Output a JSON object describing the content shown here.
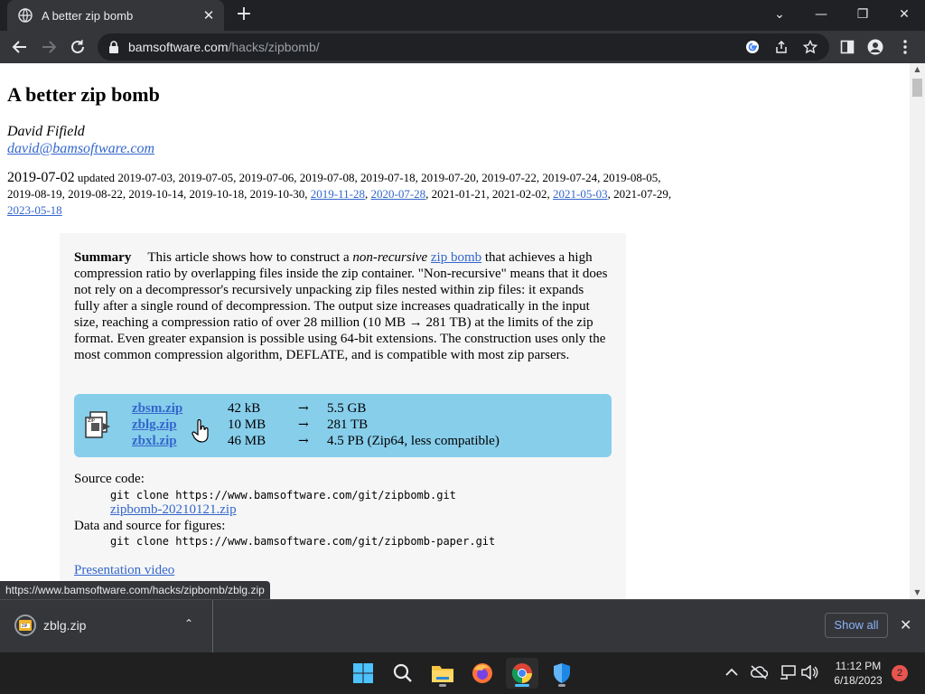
{
  "browser": {
    "tab": {
      "title": "A better zip bomb",
      "close": "✕"
    },
    "new_tab": "+",
    "window_controls": {
      "tab_search": "⌄",
      "minimize": "—",
      "restore": "❐",
      "close": "✕"
    },
    "address": {
      "domain": "bamsoftware.com",
      "path": "/hacks/zipbomb/"
    }
  },
  "page": {
    "title": "A better zip bomb",
    "author": "David Fifield",
    "email": "david@bamsoftware.com",
    "dates": {
      "published": "2019-07-02",
      "updated_label": "updated",
      "line1": "2019-07-03, 2019-07-05, 2019-07-06, 2019-07-08, 2019-07-18, 2019-07-20, 2019-07-22, 2019-07-24, 2019-08-05,",
      "line2_a": "2019-08-19, 2019-08-22, 2019-10-14, 2019-10-18, 2019-10-30, ",
      "link1": "2019-11-28",
      "sep1": ", ",
      "link2": "2020-07-28",
      "line2_b": ", 2021-01-21, 2021-02-02, ",
      "link3": "2021-05-03",
      "line2_c": ", 2021-07-29,",
      "link4": "2023-05-18"
    },
    "summary": {
      "heading": "Summary",
      "text1": "This article shows how to construct a ",
      "em": "non-recursive",
      "text2": " ",
      "link": "zip bomb",
      "text3": " that achieves a high compression ratio by overlapping files inside the zip container. \"Non-recursive\" means that it does not rely on a decompressor's recursively unpacking zip files nested within zip files: it expands fully after a single round of decompression. The output size increases quadratically in the input size, reaching a compression ratio of over 28 million (10 MB → 281 TB) at the limits of the zip format. Even greater expansion is possible using 64-bit extensions. The construction uses only the most common compression algorithm, DEFLATE, and is compatible with most zip parsers."
    },
    "files": [
      {
        "name": "zbsm.zip",
        "size": "42 kB",
        "arrow": "→",
        "result": "5.5 GB"
      },
      {
        "name": "zblg.zip",
        "size": "10 MB",
        "arrow": "→",
        "result": "281 TB"
      },
      {
        "name": "zbxl.zip",
        "size": "46 MB",
        "arrow": "→",
        "result": "4.5 PB (Zip64, less compatible)"
      }
    ],
    "source": {
      "label": "Source code:",
      "git": "git clone https://www.bamsoftware.com/git/zipbomb.git",
      "zip_link": "zipbomb-20210121.zip",
      "data_label": "Data and source for figures:",
      "data_git": "git clone https://www.bamsoftware.com/git/zipbomb-paper.git",
      "video_link": "Presentation video"
    }
  },
  "status_url": "https://www.bamsoftware.com/hacks/zipbomb/zblg.zip",
  "download_shelf": {
    "file": "zblg.zip",
    "chevron": "⌃",
    "show_all": "Show all",
    "close": "✕"
  },
  "taskbar": {
    "time": "11:12 PM",
    "date": "6/18/2023",
    "notifications": "2"
  },
  "colors": {
    "link": "#3366cc",
    "files_box": "#87ceeb",
    "accent": "#4cc2ff"
  }
}
